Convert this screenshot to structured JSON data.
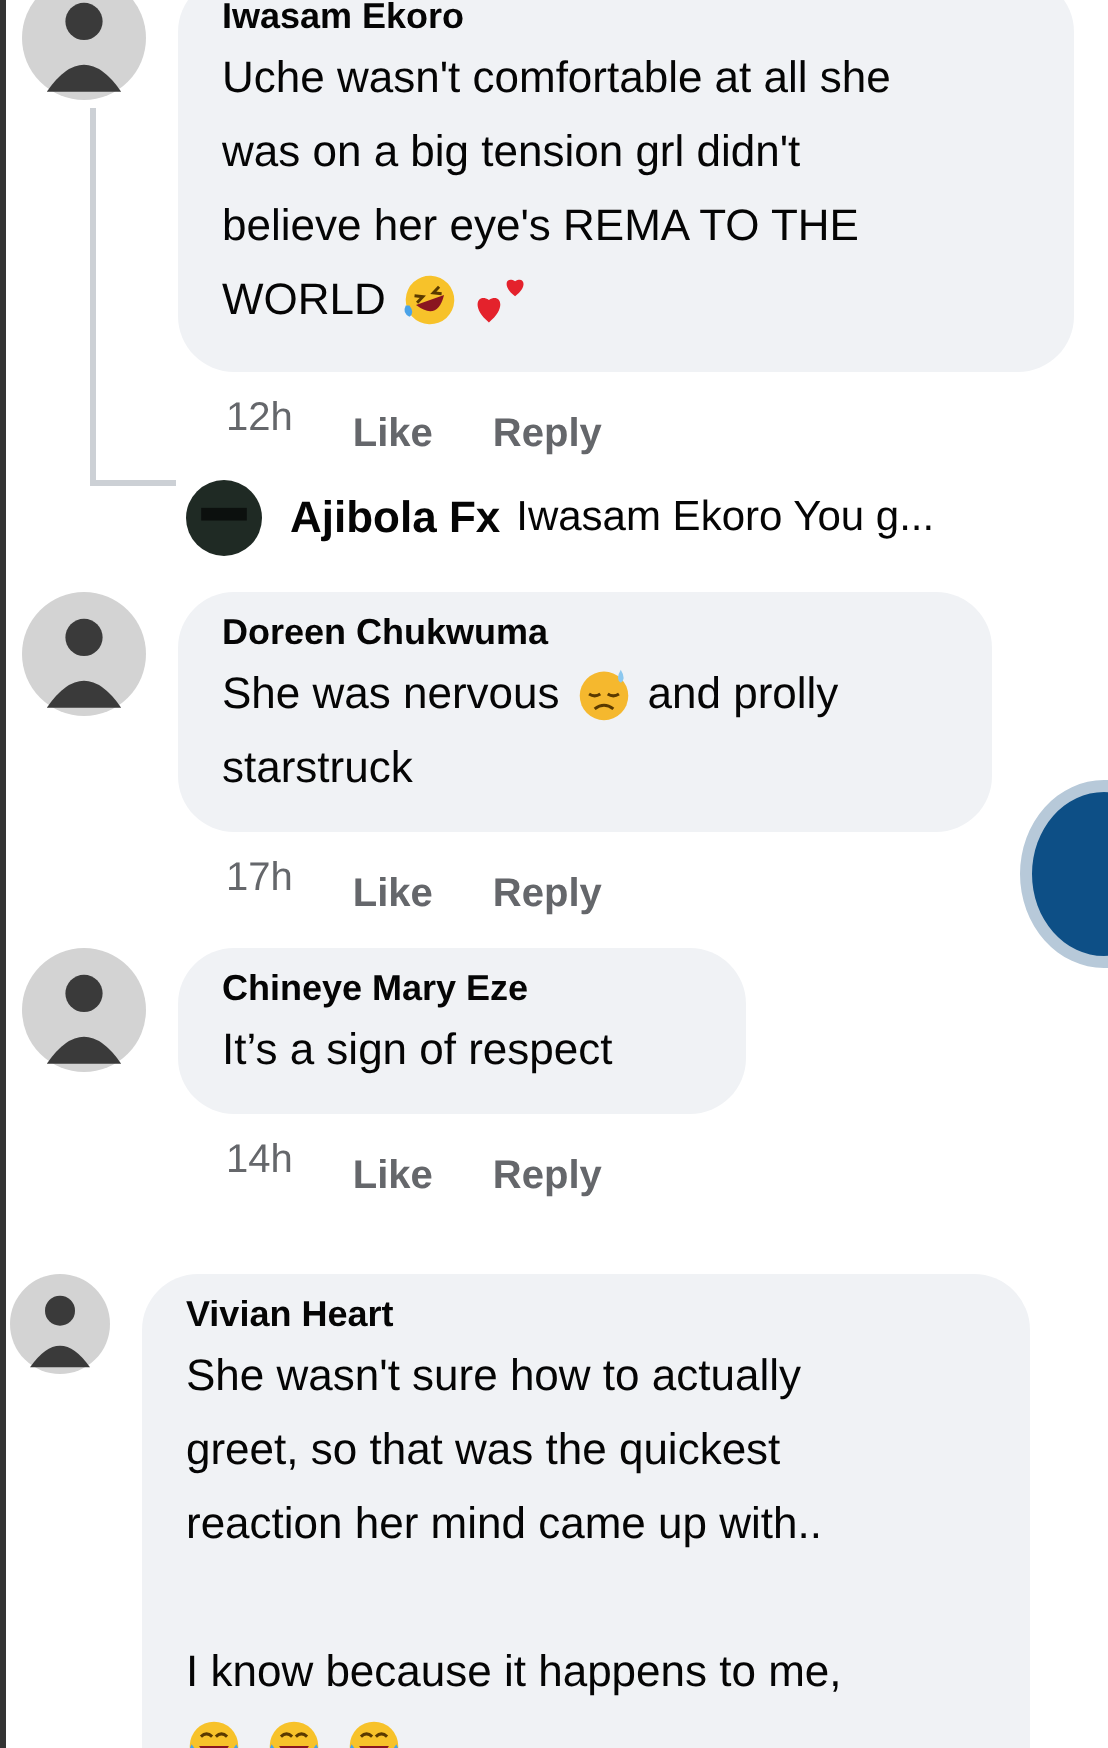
{
  "comments": [
    {
      "author": "Iwasam Ekoro",
      "lines": [
        [
          {
            "kind": "text",
            "text": "Uche wasn't comfortable at all she"
          }
        ],
        [
          {
            "kind": "text",
            "text": "was on a big tension grl didn't"
          }
        ],
        [
          {
            "kind": "text",
            "text": "believe her eye's REMA TO THE"
          }
        ],
        [
          {
            "kind": "text",
            "text": "WORLD"
          },
          {
            "kind": "rofl"
          },
          {
            "kind": "hearts"
          }
        ]
      ],
      "time": "12h",
      "like": "Like",
      "reply": "Reply",
      "replies": [
        {
          "author": "Ajibola Fx",
          "text": "Iwasam Ekoro You g..."
        }
      ]
    },
    {
      "author": "Doreen Chukwuma",
      "lines": [
        [
          {
            "kind": "text",
            "text": "She was nervous"
          },
          {
            "kind": "sweat"
          },
          {
            "kind": "text",
            "text": "and prolly"
          }
        ],
        [
          {
            "kind": "text",
            "text": "starstruck"
          }
        ]
      ],
      "time": "17h",
      "like": "Like",
      "reply": "Reply"
    },
    {
      "author": "Chineye Mary Eze",
      "lines": [
        [
          {
            "kind": "text",
            "text": "It’s a sign of respect"
          }
        ]
      ],
      "time": "14h",
      "like": "Like",
      "reply": "Reply"
    },
    {
      "author": "Vivian Heart",
      "lines": [
        [
          {
            "kind": "text",
            "text": "She wasn't sure how to actually"
          }
        ],
        [
          {
            "kind": "text",
            "text": "greet, so that was the quickest"
          }
        ],
        [
          {
            "kind": "text",
            "text": "reaction her mind came up with.."
          }
        ],
        [
          {
            "kind": "break"
          }
        ],
        [
          {
            "kind": "text",
            "text": "I know because it happens to me,"
          }
        ],
        [
          {
            "kind": "joy"
          },
          {
            "kind": "joy"
          },
          {
            "kind": "joy"
          }
        ]
      ]
    }
  ]
}
